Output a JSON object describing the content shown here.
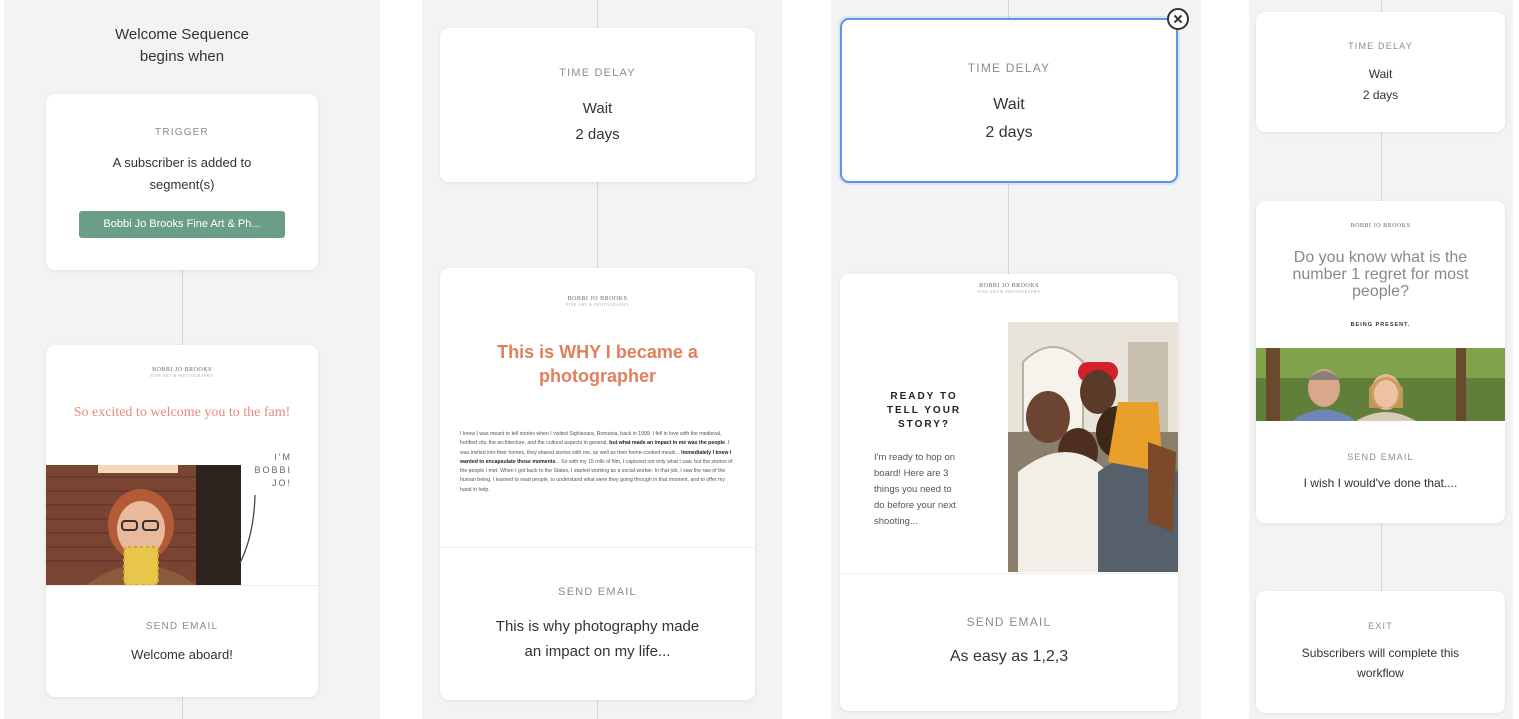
{
  "panel1": {
    "heading": "Welcome Sequence\nbegins when",
    "trigger": {
      "label": "TRIGGER",
      "text": "A subscriber is added to\nsegment(s)",
      "segment": "Bobbi Jo Brooks Fine Art & Ph..."
    },
    "email": {
      "brand": "BOBBI JO BROOKS",
      "brand_sub": "FINE ART & PHOTOGRAPHY",
      "preview_title": "So excited to welcome you to the fam!",
      "side_text": "I'M\nBOBBI\nJO!",
      "label": "SEND EMAIL",
      "subject": "Welcome aboard!"
    }
  },
  "panel2": {
    "delay": {
      "label": "TIME DELAY",
      "text": "Wait\n2 days"
    },
    "email": {
      "brand": "BOBBI JO BROOKS",
      "brand_sub": "FINE ART & PHOTOGRAPHY",
      "preview_title": "This is WHY I became a\nphotographer",
      "body_1": "I knew I was meant to tell stories when I visited Sighisoara, Romania, back in 1999. I fell in love with the medieval, fortified city, the architecture, and the cultural aspects in general, ",
      "body_bold_1": "but what made an impact in me was the people",
      "body_2": ". I was invited into their homes, they shared stories with me, as well as their home-cooked meals... ",
      "body_bold_2": "Immediately I knew I wanted to encapsulate those moments",
      "body_3": "... So with my 15 rolls of film, I captured not only what I saw, but the stories of the people I met. When I got back to the States, I started working as a social worker. In that job, I saw the raw of the human being. I learned to read people, to understand what were they going through in that moment, and to offer my hand in help.",
      "label": "SEND EMAIL",
      "subject": "This is why photography made\nan impact on my life..."
    }
  },
  "panel3": {
    "delay": {
      "label": "TIME DELAY",
      "text": "Wait\n2 days"
    },
    "email": {
      "brand": "BOBBI JO BROOKS",
      "brand_sub": "FINE ART & PHOTOGRAPHY",
      "preview_title": "READY TO\nTELL YOUR\nSTORY?",
      "preview_body": "I'm ready to hop on\nboard! Here are 3\nthings you need to\ndo before your next\nshooting...",
      "label": "SEND EMAIL",
      "subject": "As easy as 1,2,3"
    }
  },
  "panel4": {
    "delay": {
      "label": "TIME DELAY",
      "text": "Wait\n2 days"
    },
    "email": {
      "brand": "BOBBI JO BROOKS",
      "preview_title": "Do you know what is the\nnumber 1 regret for most\npeople?",
      "preview_sub": "BEING PRESENT.",
      "label": "SEND EMAIL",
      "subject": "I wish I would've done that...."
    },
    "exit": {
      "label": "EXIT",
      "text": "Subscribers will complete this\nworkflow"
    }
  },
  "colors": {
    "accent_orange": "#e07f5c",
    "pink": "#e88a7d",
    "segment_green": "#6a9e86",
    "selected_blue": "#5b95e3"
  }
}
